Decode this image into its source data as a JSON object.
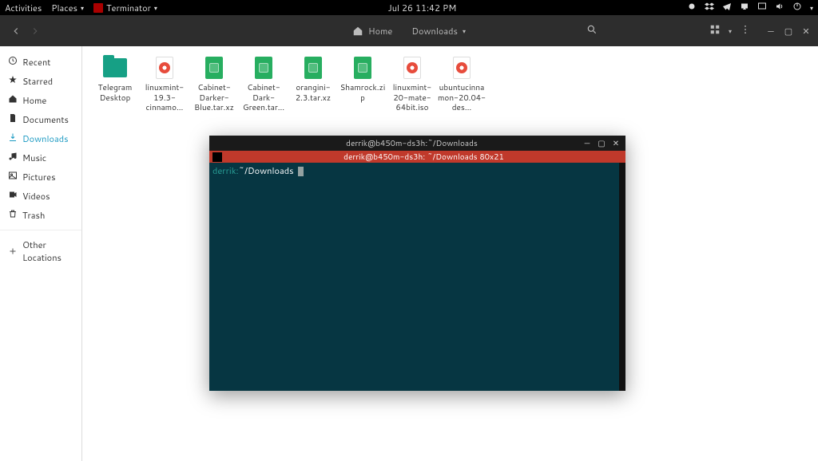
{
  "panel": {
    "activities": "Activities",
    "places": "Places",
    "app": "Terminator",
    "clock": "Jul 26  11:42 PM"
  },
  "files": {
    "home_crumb": "Home",
    "downloads_crumb": "Downloads"
  },
  "sidebar": {
    "items": [
      {
        "label": "Recent",
        "icon": "clock"
      },
      {
        "label": "Starred",
        "icon": "star"
      },
      {
        "label": "Home",
        "icon": "home"
      },
      {
        "label": "Documents",
        "icon": "doc"
      },
      {
        "label": "Downloads",
        "icon": "download",
        "active": true
      },
      {
        "label": "Music",
        "icon": "music"
      },
      {
        "label": "Pictures",
        "icon": "picture"
      },
      {
        "label": "Videos",
        "icon": "video"
      },
      {
        "label": "Trash",
        "icon": "trash"
      }
    ],
    "other": "Other Locations"
  },
  "filesList": [
    {
      "name": "Telegram Desktop",
      "type": "folder"
    },
    {
      "name": "linuxmint-19.3-cinnamo…",
      "type": "iso"
    },
    {
      "name": "Cabinet-Darker-Blue.tar.xz",
      "type": "archive"
    },
    {
      "name": "Cabinet-Dark-Green.tar…",
      "type": "archive"
    },
    {
      "name": "orangini-2.3.tar.xz",
      "type": "archive"
    },
    {
      "name": "Shamrock.zip",
      "type": "archive"
    },
    {
      "name": "linuxmint-20-mate-64bit.iso",
      "type": "iso"
    },
    {
      "name": "ubuntucinnamon-20.04-des…",
      "type": "iso"
    }
  ],
  "terminal": {
    "title": "derrik@b450m-ds3h:~/Downloads",
    "subtitle": "derrik@b450m-ds3h: ~/Downloads 80x21",
    "prompt_user": "derrik:",
    "prompt_path": "~/Downloads"
  }
}
